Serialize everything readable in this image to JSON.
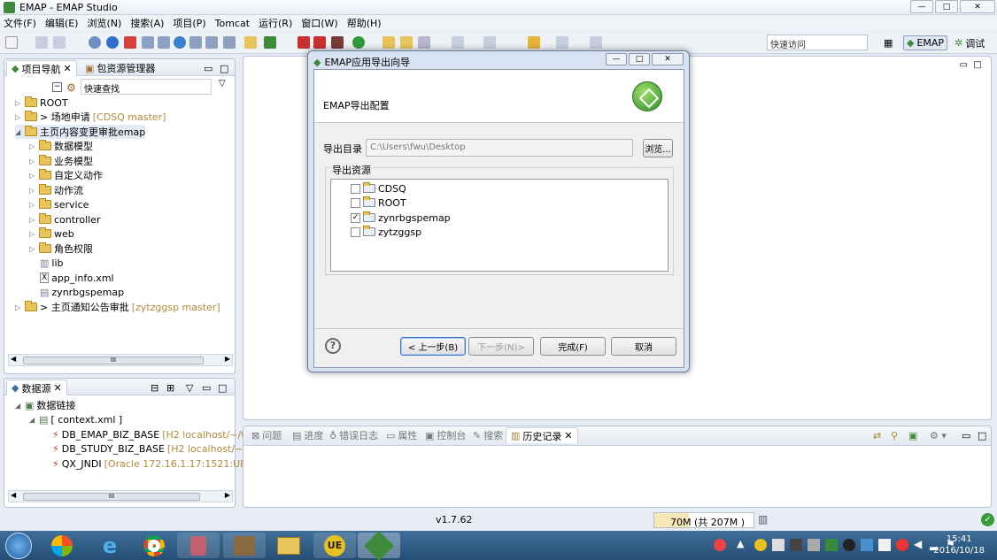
{
  "window": {
    "title": "EMAP - EMAP Studio",
    "min": "—",
    "max": "□",
    "close": "✕"
  },
  "menu": [
    "文件(F)",
    "编辑(E)",
    "浏览(N)",
    "搜索(A)",
    "项目(P)",
    "Tomcat",
    "运行(R)",
    "窗口(W)",
    "帮助(H)"
  ],
  "toolbar": {
    "quick_access_placeholder": "快速访问",
    "perspective_emap": "EMAP",
    "perspective_debug": "调试"
  },
  "nav_panel": {
    "tabs": [
      "项目导航",
      "包资源管理器"
    ],
    "filter_placeholder": "快速查找",
    "tree": [
      {
        "label": "ROOT",
        "suffix": "",
        "level": 0
      },
      {
        "label": "> 场地申请",
        "suffix": "[CDSQ master]",
        "level": 0
      },
      {
        "label": "主页内容变更审批emap",
        "suffix": "",
        "level": 0
      },
      {
        "label": "数据模型",
        "suffix": "",
        "level": 1
      },
      {
        "label": "业务模型",
        "suffix": "",
        "level": 1
      },
      {
        "label": "自定义动作",
        "suffix": "",
        "level": 1
      },
      {
        "label": "动作流",
        "suffix": "",
        "level": 1
      },
      {
        "label": "service",
        "suffix": "",
        "level": 1
      },
      {
        "label": "controller",
        "suffix": "",
        "level": 1
      },
      {
        "label": "web",
        "suffix": "",
        "level": 1
      },
      {
        "label": "角色权限",
        "suffix": "",
        "level": 1
      },
      {
        "label": "lib",
        "suffix": "",
        "level": 1
      },
      {
        "label": "app_info.xml",
        "suffix": "",
        "level": 1
      },
      {
        "label": "zynrbgspemap",
        "suffix": "",
        "level": 1
      },
      {
        "label": "> 主页通知公告审批",
        "suffix": "[zytzggsp master]",
        "level": 0
      }
    ],
    "scroll_grip": "III"
  },
  "datasource_panel": {
    "tab": "数据源",
    "tree": [
      {
        "label": "数据链接",
        "suffix": ""
      },
      {
        "label": "[ context.xml ]",
        "suffix": ""
      },
      {
        "label": "DB_EMAP_BIZ_BASE",
        "suffix": "[H2 localhost/~/t"
      },
      {
        "label": "DB_STUDY_BIZ_BASE",
        "suffix": "[H2 localhost/~/"
      },
      {
        "label": "QX_JNDI",
        "suffix": "[Oracle 172.16.1.17:1521:URI"
      }
    ],
    "scroll_grip": "III"
  },
  "dialog": {
    "title": "EMAP应用导出向导",
    "heading": "EMAP导出配置",
    "export_dir_label": "导出目录",
    "export_dir_value": "C:\\Users\\fwu\\Desktop",
    "browse_button": "浏览...",
    "resources_label": "导出资源",
    "resources": [
      {
        "name": "CDSQ",
        "checked": false
      },
      {
        "name": "ROOT",
        "checked": false
      },
      {
        "name": "zynrbgspemap",
        "checked": true
      },
      {
        "name": "zytzggsp",
        "checked": false
      }
    ],
    "help_icon": "?",
    "back_button": "< 上一步(B)",
    "next_button": "下一步(N)>",
    "finish_button": "完成(F)",
    "cancel_button": "取消"
  },
  "lower_panel": {
    "tabs": [
      "问题",
      "进度",
      "错误日志",
      "属性",
      "控制台",
      "搜索",
      "历史记录"
    ],
    "active_tab": "历史记录"
  },
  "status": {
    "version": "v1.7.62",
    "memory": "70M (共 207M )"
  },
  "taskbar": {
    "time": "15:41",
    "date": "2016/10/18"
  }
}
